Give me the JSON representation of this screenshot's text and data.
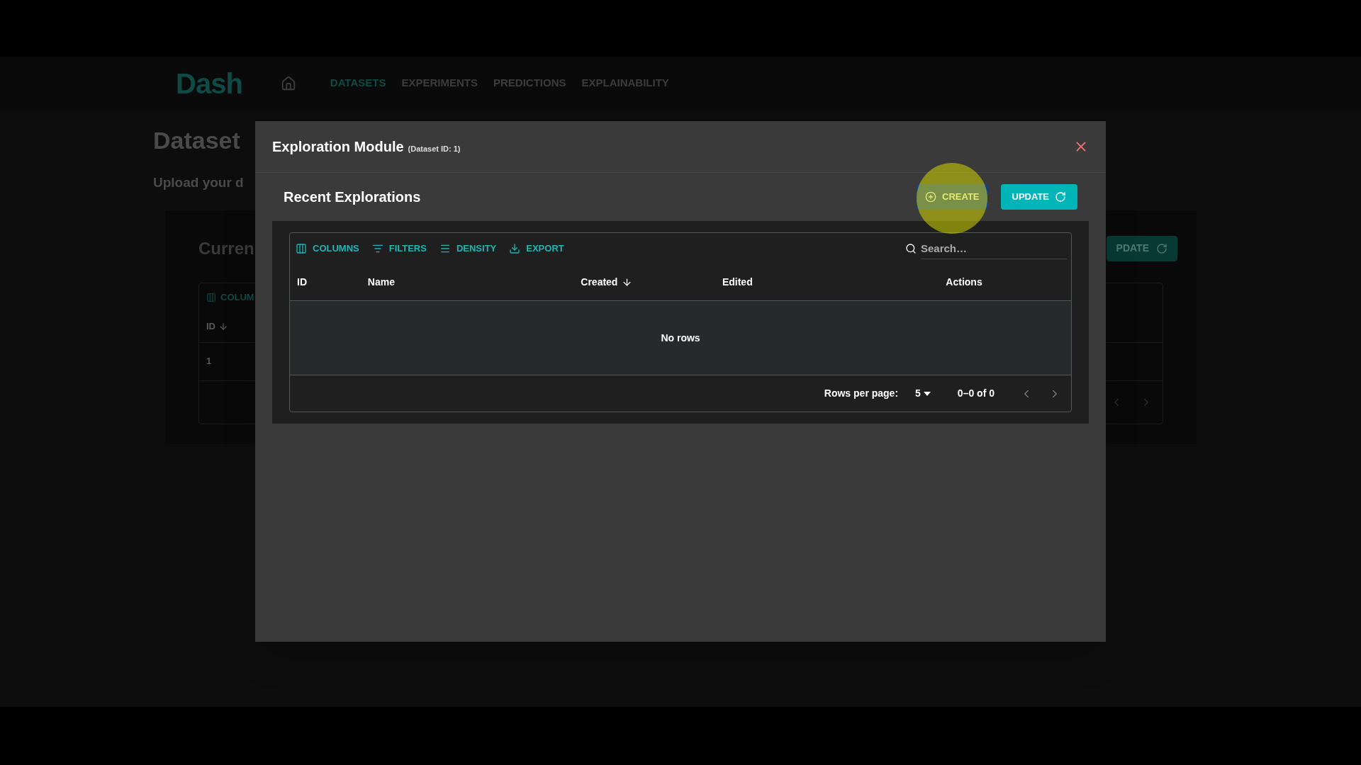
{
  "header": {
    "logo": "Dash",
    "nav": [
      {
        "label": "DATASETS",
        "selected": true
      },
      {
        "label": "EXPERIMENTS",
        "selected": false
      },
      {
        "label": "PREDICTIONS",
        "selected": false
      },
      {
        "label": "EXPLAINABILITY",
        "selected": false
      }
    ]
  },
  "background_page": {
    "title": "Dataset",
    "subtitle": "Upload your d",
    "card": {
      "title": "Curren",
      "toolbar_item": "COLUM",
      "column": "ID",
      "row_cell": "1",
      "button": "PDATE"
    }
  },
  "modal": {
    "title": "Exploration Module",
    "subtitle": "(Dataset ID: 1)",
    "section_title": "Recent Explorations",
    "buttons": [
      {
        "label": "CREATE",
        "kind": "create"
      },
      {
        "label": "UPDATE",
        "kind": "update"
      }
    ],
    "toolbar": [
      {
        "label": "COLUMNS",
        "kind": "columns"
      },
      {
        "label": "FILTERS",
        "kind": "filters"
      },
      {
        "label": "DENSITY",
        "kind": "density"
      },
      {
        "label": "EXPORT",
        "kind": "export"
      }
    ],
    "search": {
      "placeholder": "Search…"
    },
    "columns": [
      {
        "label": "ID",
        "sorted": false
      },
      {
        "label": "Name",
        "sorted": false
      },
      {
        "label": "Created",
        "sorted": true
      },
      {
        "label": "Edited",
        "sorted": false
      },
      {
        "label": "Actions",
        "sorted": false
      }
    ],
    "empty_text": "No rows",
    "pagination": {
      "rows_label": "Rows per page:",
      "rows_value": "5",
      "range": "0–0 of 0"
    }
  }
}
